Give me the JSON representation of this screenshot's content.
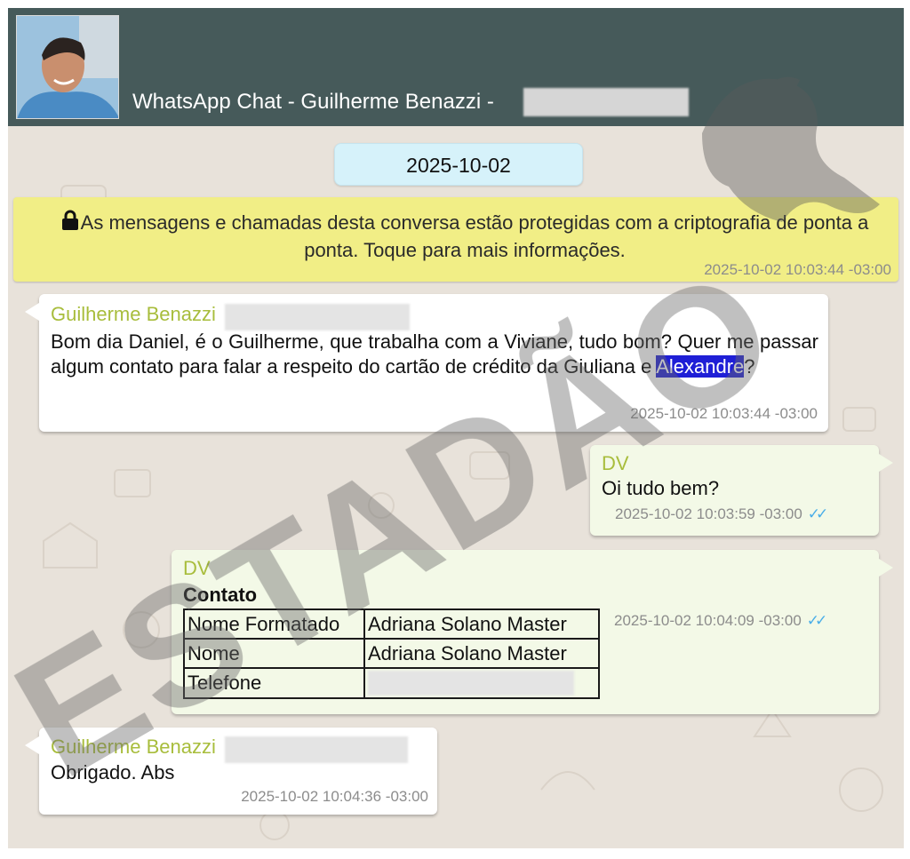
{
  "header": {
    "title": "WhatsApp Chat - Guilherme Benazzi - "
  },
  "date_divider": "2025-10-02",
  "encryption_notice": {
    "text": "As mensagens e chamadas desta conversa estão protegidas com a criptografia de ponta a ponta. Toque para mais informações.",
    "timestamp": "2025-10-02 10:03:44 -03:00"
  },
  "messages": [
    {
      "sender": "Guilherme Benazzi",
      "text_before": "Bom dia Daniel, é o Guilherme, que trabalha com a Viviane, tudo bom? Quer me passar algum contato para falar a respeito do cartão de crédito da Giuliana e ",
      "highlight": "Alexandre",
      "text_after": "?",
      "timestamp": "2025-10-02 10:03:44 -03:00"
    },
    {
      "sender": "DV",
      "text": "Oi tudo bem?",
      "timestamp": "2025-10-02 10:03:59 -03:00",
      "ticks": "✓✓"
    },
    {
      "sender": "DV",
      "contact_title": "Contato",
      "contact_rows": [
        {
          "label": "Nome Formatado",
          "value": "Adriana Solano Master"
        },
        {
          "label": "Nome",
          "value": "Adriana Solano Master"
        },
        {
          "label": "Telefone",
          "value": ""
        }
      ],
      "timestamp": "2025-10-02 10:04:09 -03:00",
      "ticks": "✓✓"
    },
    {
      "sender": "Guilherme Benazzi",
      "text": "Obrigado. Abs",
      "timestamp": "2025-10-02 10:04:36 -03:00"
    }
  ],
  "watermark": "ESTADÃO",
  "colors": {
    "header": "#465a5a",
    "notice": "#f1ee86",
    "sender": "#a8bd3c",
    "outgoing": "#f3f9e7",
    "ticks": "#4aaee8",
    "highlight": "#1f1fd6"
  }
}
